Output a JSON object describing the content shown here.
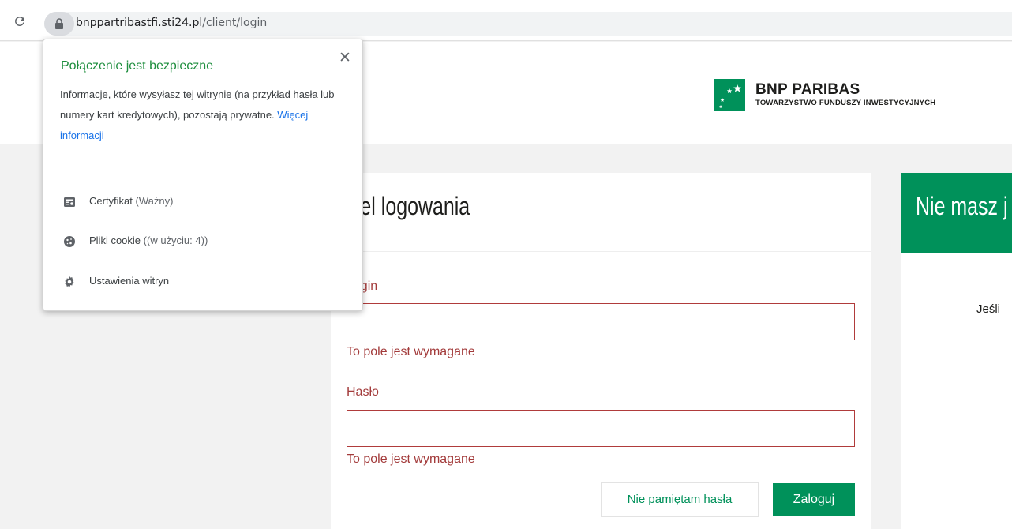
{
  "browser": {
    "url_host": "bnppartribastfi.sti24.pl",
    "url_path": "/client/login"
  },
  "site": {
    "brand_name": "BNP PARIBAS",
    "brand_subtitle": "TOWARZYSTWO FUNDUSZY INWESTYCYJNYCH"
  },
  "login_panel": {
    "title": "Panel logowania",
    "login_label": "Login",
    "login_value": "",
    "login_error": "To pole jest wymagane",
    "password_label": "Hasło",
    "password_value": "",
    "password_error": "To pole jest wymagane",
    "forgot_button": "Nie pamiętam hasła",
    "submit_button": "Zaloguj"
  },
  "right_panel": {
    "title": "Nie masz j",
    "text": "Jeśli"
  },
  "security_popup": {
    "title": "Połączenie jest bezpieczne",
    "description": "Informacje, które wysyłasz tej witrynie (na przykład hasła lub numery kart kredytowych), pozostają prywatne.",
    "more_info_link": "Więcej informacji",
    "rows": [
      {
        "label": "Certyfikat",
        "detail": "(Ważny)",
        "icon": "certificate-icon"
      },
      {
        "label": "Pliki cookie",
        "detail": "((w użyciu: 4))",
        "icon": "cookie-icon"
      },
      {
        "label": "Ustawienia witryn",
        "detail": "",
        "icon": "gear-icon"
      }
    ]
  },
  "colors": {
    "brand_green": "#00915a",
    "error_red": "#a33b3b",
    "secure_green": "#1e8e3e",
    "link_blue": "#1a73e8"
  }
}
